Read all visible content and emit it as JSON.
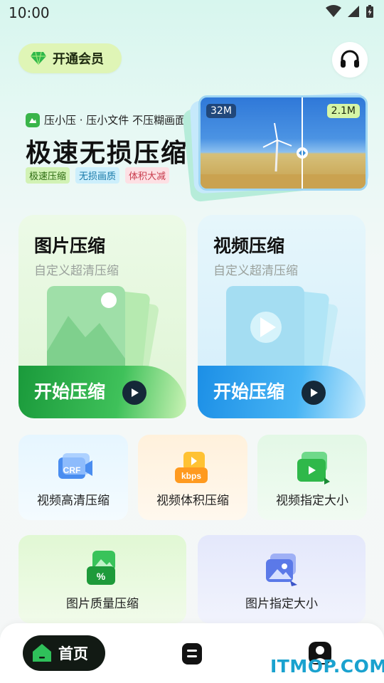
{
  "status_bar": {
    "time": "10:00"
  },
  "header": {
    "vip_label": "开通会员"
  },
  "hero": {
    "brand": "压小压 · 压小文件 不压糊画面",
    "headline": "极速无损压缩",
    "tags": [
      "极速压缩",
      "无损画质",
      "体积大减"
    ],
    "before_size": "32M",
    "after_size": "2.1M"
  },
  "cards": {
    "image": {
      "title": "图片压缩",
      "subtitle": "自定义超清压缩",
      "action": "开始压缩"
    },
    "video": {
      "title": "视频压缩",
      "subtitle": "自定义超清压缩",
      "action": "开始压缩"
    }
  },
  "tools": [
    {
      "label": "视频高清压缩",
      "icon": "crf-video-icon",
      "badge": "CRF"
    },
    {
      "label": "视频体积压缩",
      "icon": "kbps-video-icon",
      "badge": "kbps"
    },
    {
      "label": "视频指定大小",
      "icon": "video-size-icon"
    },
    {
      "label": "图片质量压缩",
      "icon": "image-quality-icon",
      "badge": "%"
    },
    {
      "label": "图片指定大小",
      "icon": "image-size-icon"
    }
  ],
  "nav": {
    "home_label": "首页"
  },
  "watermark": "ITMOP.COM",
  "colors": {
    "green": "#1a9a3b",
    "blue": "#1c8fe6",
    "dark": "#121a14"
  }
}
